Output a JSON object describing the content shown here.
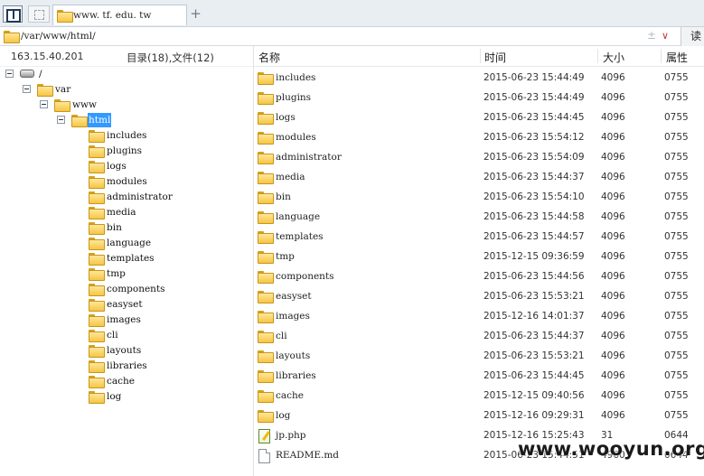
{
  "tabbar": {
    "tab_title": "www. tf. edu. tw",
    "add_tab": "+"
  },
  "pathbar": {
    "path": "/var/www/html/",
    "ctrl": "±",
    "read_button": "读"
  },
  "left_header": {
    "host": "163.15.40.201",
    "summary": "目录(18),文件(12)"
  },
  "tree": {
    "root": "/",
    "var": "var",
    "www": "www",
    "html": "html",
    "children": [
      "includes",
      "plugins",
      "logs",
      "modules",
      "administrator",
      "media",
      "bin",
      "language",
      "templates",
      "tmp",
      "components",
      "easyset",
      "images",
      "cli",
      "layouts",
      "libraries",
      "cache",
      "log"
    ]
  },
  "columns": {
    "name": "名称",
    "time": "时间",
    "size": "大小",
    "attr": "属性"
  },
  "files": [
    {
      "name": "includes",
      "time": "2015-06-23 15:44:49",
      "size": "4096",
      "attr": "0755",
      "type": "folder"
    },
    {
      "name": "plugins",
      "time": "2015-06-23 15:44:49",
      "size": "4096",
      "attr": "0755",
      "type": "folder"
    },
    {
      "name": "logs",
      "time": "2015-06-23 15:44:45",
      "size": "4096",
      "attr": "0755",
      "type": "folder"
    },
    {
      "name": "modules",
      "time": "2015-06-23 15:54:12",
      "size": "4096",
      "attr": "0755",
      "type": "folder"
    },
    {
      "name": "administrator",
      "time": "2015-06-23 15:54:09",
      "size": "4096",
      "attr": "0755",
      "type": "folder"
    },
    {
      "name": "media",
      "time": "2015-06-23 15:44:37",
      "size": "4096",
      "attr": "0755",
      "type": "folder"
    },
    {
      "name": "bin",
      "time": "2015-06-23 15:54:10",
      "size": "4096",
      "attr": "0755",
      "type": "folder"
    },
    {
      "name": "language",
      "time": "2015-06-23 15:44:58",
      "size": "4096",
      "attr": "0755",
      "type": "folder"
    },
    {
      "name": "templates",
      "time": "2015-06-23 15:44:57",
      "size": "4096",
      "attr": "0755",
      "type": "folder"
    },
    {
      "name": "tmp",
      "time": "2015-12-15 09:36:59",
      "size": "4096",
      "attr": "0755",
      "type": "folder"
    },
    {
      "name": "components",
      "time": "2015-06-23 15:44:56",
      "size": "4096",
      "attr": "0755",
      "type": "folder"
    },
    {
      "name": "easyset",
      "time": "2015-06-23 15:53:21",
      "size": "4096",
      "attr": "0755",
      "type": "folder"
    },
    {
      "name": "images",
      "time": "2015-12-16 14:01:37",
      "size": "4096",
      "attr": "0755",
      "type": "folder"
    },
    {
      "name": "cli",
      "time": "2015-06-23 15:44:37",
      "size": "4096",
      "attr": "0755",
      "type": "folder"
    },
    {
      "name": "layouts",
      "time": "2015-06-23 15:53:21",
      "size": "4096",
      "attr": "0755",
      "type": "folder"
    },
    {
      "name": "libraries",
      "time": "2015-06-23 15:44:45",
      "size": "4096",
      "attr": "0755",
      "type": "folder"
    },
    {
      "name": "cache",
      "time": "2015-12-15 09:40:56",
      "size": "4096",
      "attr": "0755",
      "type": "folder"
    },
    {
      "name": "log",
      "time": "2015-12-16 09:29:31",
      "size": "4096",
      "attr": "0755",
      "type": "folder"
    },
    {
      "name": "jp.php",
      "time": "2015-12-16 15:25:43",
      "size": "31",
      "attr": "0644",
      "type": "php"
    },
    {
      "name": "README.md",
      "time": "2015-06-23 15:44:51",
      "size": "4960",
      "attr": "0644",
      "type": "file"
    }
  ],
  "watermark": "www.wooyun.org"
}
